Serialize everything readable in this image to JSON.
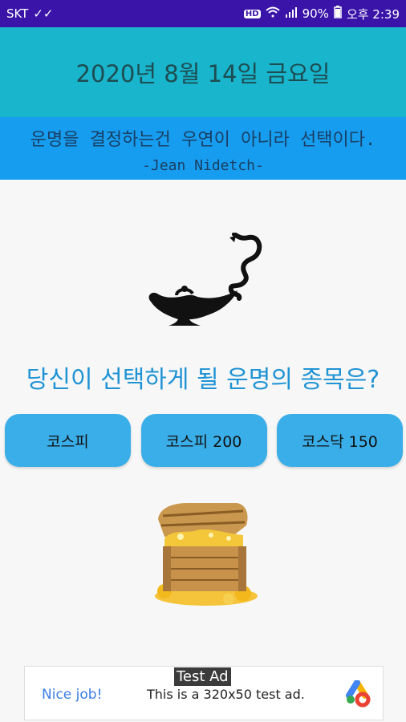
{
  "status_bar": {
    "carrier": "SKT",
    "volte": "HD Voice",
    "battery": "90%",
    "time": "오후 2:39"
  },
  "header": {
    "date": "2020년 8월 14일 금요일"
  },
  "quote": {
    "text": "운명을 결정하는건 우연이 아니라 선택이다.",
    "author": "-Jean Nidetch-"
  },
  "main": {
    "question": "당신이 선택하게 될 운명의 종목은?",
    "choices": [
      "코스피",
      "코스피 200",
      "코스닥 150"
    ]
  },
  "ad": {
    "label": "Test Ad",
    "nice": "Nice job!",
    "description": "This is a 320x50 test ad."
  },
  "colors": {
    "status_bar": "#3a13a8",
    "date_bar": "#18b5cc",
    "quote_bar": "#179df0",
    "button": "#3aaee8",
    "question_text": "#1f93d4"
  },
  "icons": [
    "lamp-icon",
    "treasure-chest-icon",
    "wifi-icon",
    "signal-icon",
    "battery-icon",
    "ad-logo-icon"
  ]
}
